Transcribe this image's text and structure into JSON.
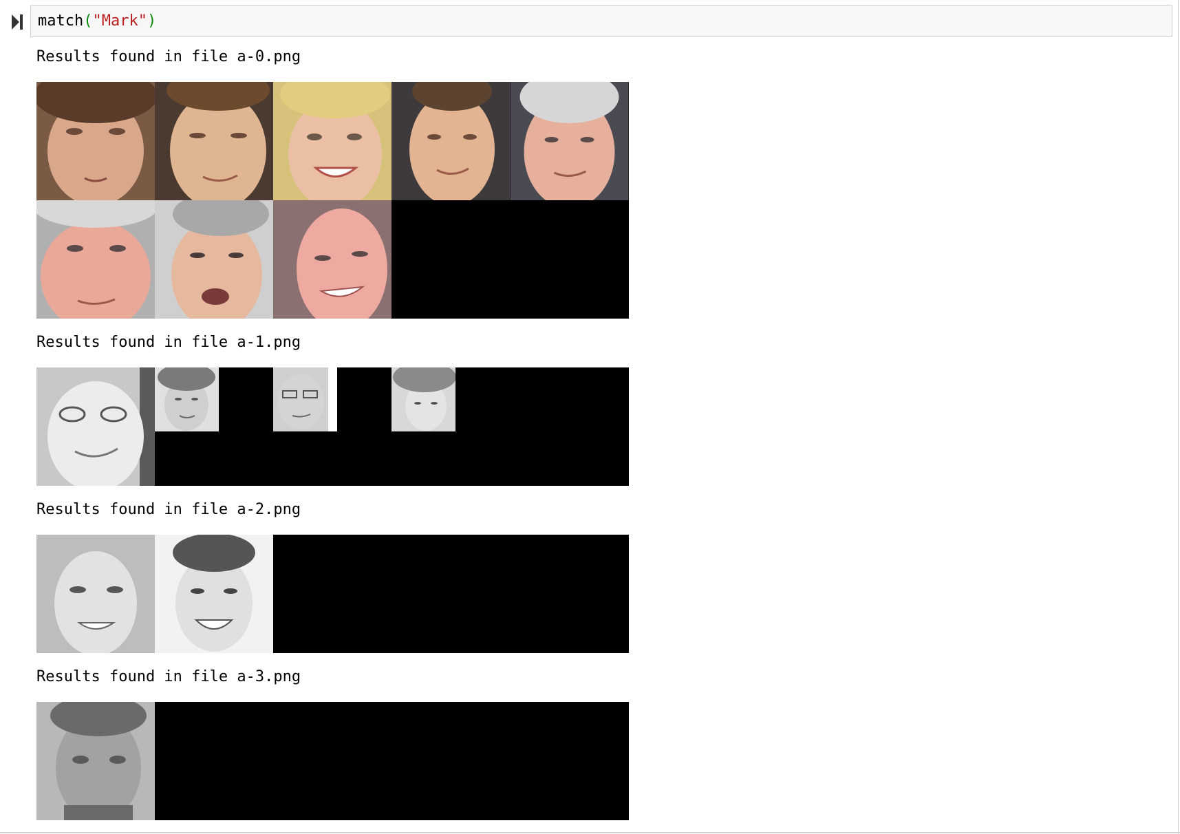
{
  "cell": {
    "run_icon": "run-cell-icon",
    "code": {
      "func": "match",
      "open_paren": "(",
      "arg": "\"Mark\"",
      "close_paren": ")"
    }
  },
  "results": [
    {
      "label": "Results found in file a-0.png",
      "faces": 8
    },
    {
      "label": "Results found in file a-1.png",
      "faces": 4
    },
    {
      "label": "Results found in file a-2.png",
      "faces": 2
    },
    {
      "label": "Results found in file a-3.png",
      "faces": 1
    }
  ],
  "colors": {
    "keyword_paren": "#0a8a0a",
    "string": "#ba2121",
    "input_bg": "#f7f7f7",
    "tile_bg": "#000000"
  }
}
